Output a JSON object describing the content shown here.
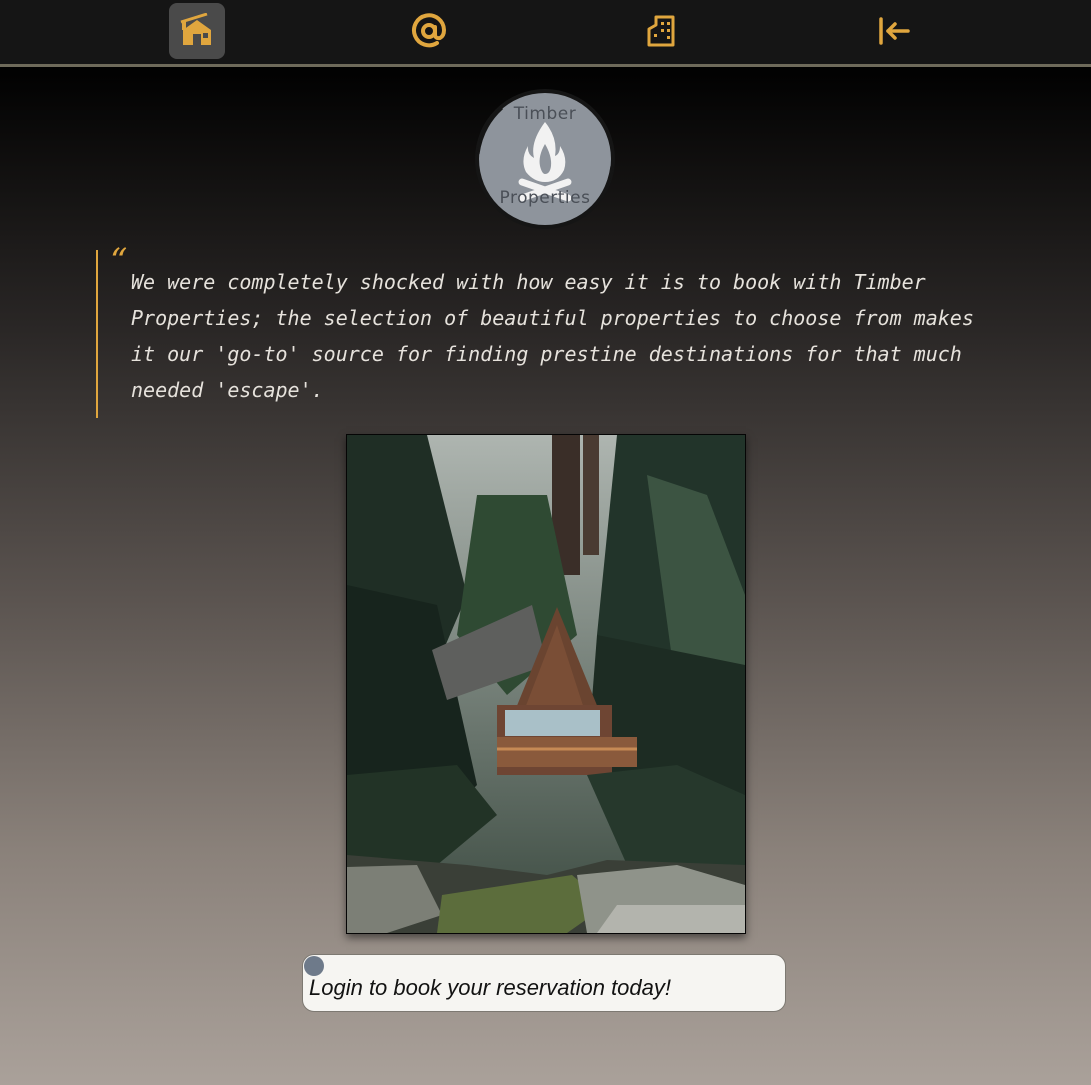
{
  "navbar": {
    "items": [
      {
        "icon": "house-icon",
        "active": true
      },
      {
        "icon": "at-sign-icon",
        "active": false
      },
      {
        "icon": "building-icon",
        "active": false
      },
      {
        "icon": "arrow-bar-left-icon",
        "active": false
      }
    ],
    "accent_color": "#e0a63e"
  },
  "logo": {
    "top_text": "Timber",
    "bottom_text": "Properties"
  },
  "testimonial": {
    "quote_mark": "“",
    "text": "We were completely shocked with how easy it is to book with Timber Properties; the selection of beautiful properties to choose from makes it our 'go-to' source for finding prestine destinations for that much needed 'escape'."
  },
  "cta": {
    "label": "Login to book your reservation today!"
  }
}
